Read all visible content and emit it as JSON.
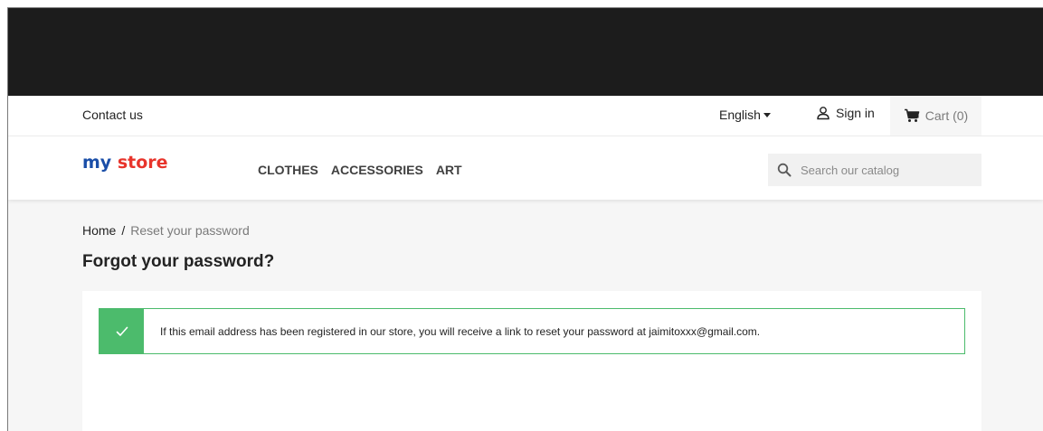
{
  "header": {
    "contact_label": "Contact us",
    "language": "English",
    "signin_label": "Sign in",
    "cart_label": "Cart (0)"
  },
  "logo": {
    "part1": "my",
    "part2": "store"
  },
  "menu": {
    "items": [
      {
        "label": "CLOTHES"
      },
      {
        "label": "ACCESSORIES"
      },
      {
        "label": "ART"
      }
    ]
  },
  "search": {
    "placeholder": "Search our catalog"
  },
  "breadcrumb": {
    "home": "Home",
    "separator": "/",
    "current": "Reset your password"
  },
  "page": {
    "title": "Forgot your password?"
  },
  "alert": {
    "message": "If this email address has been registered in our store, you will receive a link to reset your password at jaimitoxxx@gmail.com."
  },
  "colors": {
    "banner": "#1c1c1c",
    "success": "#4cbb6c",
    "logo_blue": "#1a4ea8",
    "logo_red": "#e8342b"
  },
  "icons": {
    "account": "user-icon",
    "cart": "cart-icon",
    "search": "search-icon",
    "alert": "check-icon",
    "language": "caret-down-icon"
  }
}
